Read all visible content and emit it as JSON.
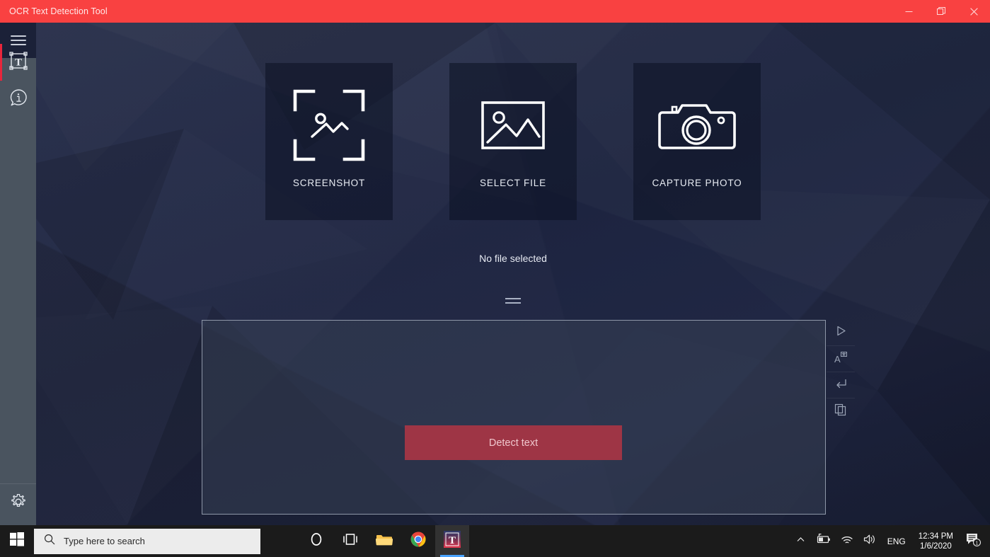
{
  "window": {
    "title": "OCR Text Detection Tool",
    "accent_red": "#f94141",
    "controls": [
      {
        "name": "minimize",
        "label": "Minimize"
      },
      {
        "name": "maximize",
        "label": "Restore"
      },
      {
        "name": "close",
        "label": "Close"
      }
    ]
  },
  "sidebar": {
    "menu_icon": "hamburger-menu-icon",
    "items": [
      {
        "icon": "text-detect-icon",
        "label": "Text Detection",
        "active": true
      },
      {
        "icon": "info-bubble-icon",
        "label": "About",
        "active": false
      }
    ],
    "bottom": {
      "icon": "gear-icon",
      "label": "Settings"
    }
  },
  "main": {
    "cards": [
      {
        "icon": "screenshot-frame-icon",
        "label": "SCREENSHOT"
      },
      {
        "icon": "image-file-icon",
        "label": "SELECT FILE"
      },
      {
        "icon": "camera-icon",
        "label": "CAPTURE PHOTO"
      }
    ],
    "file_status": "No file selected",
    "resize_grip": "resize-grip-icon",
    "result_text": "",
    "result_placeholder": "",
    "detect_button": {
      "label": "Detect text",
      "bg": "#9e3545",
      "fg": "#f0c7cd"
    },
    "tools": [
      {
        "icon": "play-run-icon",
        "label": "Run detection"
      },
      {
        "icon": "translate-icon",
        "label": "Translate"
      },
      {
        "icon": "newline-icon",
        "label": "Insert newline"
      },
      {
        "icon": "copy-icon",
        "label": "Copy text"
      }
    ]
  },
  "taskbar": {
    "start": "windows-start-icon",
    "search": {
      "placeholder": "Type here to search",
      "icon": "search-icon"
    },
    "items": [
      {
        "icon": "cortana-icon",
        "label": "Cortana",
        "active": false
      },
      {
        "icon": "task-view-icon",
        "label": "Task View",
        "active": false
      },
      {
        "icon": "file-explorer-icon",
        "label": "File Explorer",
        "active": false
      },
      {
        "icon": "chrome-icon",
        "label": "Google Chrome",
        "active": false
      },
      {
        "icon": "ocr-app-icon",
        "label": "OCR Text Detection Tool",
        "active": true
      }
    ],
    "tray": {
      "overflow_icon": "chevron-up-icon",
      "battery_icon": "battery-charging-icon",
      "network_icon": "wifi-icon",
      "volume_icon": "speaker-icon",
      "language": "ENG",
      "time": "12:34 PM",
      "date": "1/6/2020",
      "notifications_icon": "notification-icon",
      "notifications_count": "1"
    }
  }
}
